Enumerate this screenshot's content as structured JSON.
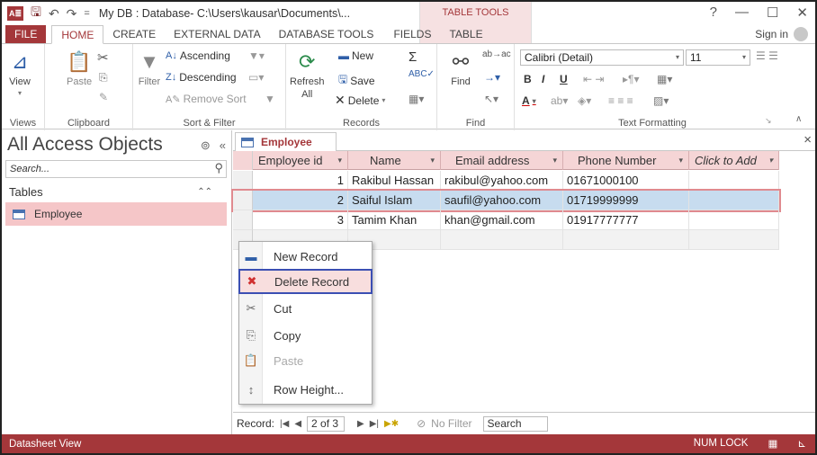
{
  "window": {
    "title": "My DB : Database- C:\\Users\\kausar\\Documents\\...",
    "context_tab_group": "TABLE TOOLS",
    "help": "?",
    "minimize": "—",
    "restore": "☐",
    "close": "✕"
  },
  "qat": {
    "save": "🖫",
    "undo": "↶",
    "redo": "↷",
    "customize": "="
  },
  "ribbon_tabs": [
    "FILE",
    "HOME",
    "CREATE",
    "EXTERNAL DATA",
    "DATABASE TOOLS",
    "FIELDS",
    "TABLE"
  ],
  "active_tab": "HOME",
  "signin": "Sign in",
  "ribbon": {
    "views": {
      "view_label": "View",
      "group": "Views"
    },
    "clipboard": {
      "paste_label": "Paste",
      "group": "Clipboard"
    },
    "sort_filter": {
      "filter_label": "Filter",
      "ascending": "Ascending",
      "descending": "Descending",
      "remove_sort": "Remove Sort",
      "group": "Sort & Filter"
    },
    "records": {
      "refresh_label": "Refresh",
      "refresh_sub": "All",
      "new": "New",
      "save": "Save",
      "delete": "Delete",
      "group": "Records"
    },
    "find": {
      "find_label": "Find",
      "group": "Find"
    },
    "text_formatting": {
      "font": "Calibri (Detail)",
      "size": "11",
      "bold": "B",
      "italic": "I",
      "underline": "U",
      "font_color": "A",
      "group": "Text Formatting"
    }
  },
  "nav_pane": {
    "title": "All Access Objects",
    "search_placeholder": "Search...",
    "section": "Tables",
    "items": [
      "Employee"
    ]
  },
  "document_tab": "Employee",
  "table": {
    "columns": [
      "Employee id",
      "Name",
      "Email address",
      "Phone Number",
      "Click to Add"
    ],
    "rows": [
      [
        "1",
        "Rakibul Hassan",
        "rakibul@yahoo.com",
        "01671000100",
        ""
      ],
      [
        "2",
        "Saiful Islam",
        "saufil@yahoo.com",
        "01719999999",
        ""
      ],
      [
        "3",
        "Tamim Khan",
        "khan@gmail.com",
        "01917777777",
        ""
      ]
    ],
    "selected_row": 2
  },
  "context_menu": {
    "items": [
      {
        "label": "New Record",
        "icon": "new-record-icon",
        "glyph": "▬"
      },
      {
        "label": "Delete Record",
        "icon": "delete-record-icon",
        "glyph": "✖"
      },
      {
        "label": "Cut",
        "icon": "scissors-icon",
        "glyph": "✂"
      },
      {
        "label": "Copy",
        "icon": "copy-icon",
        "glyph": "⎘"
      },
      {
        "label": "Paste",
        "icon": "paste-icon",
        "glyph": "📋"
      },
      {
        "label": "Row Height...",
        "icon": "row-height-icon",
        "glyph": "↕"
      }
    ],
    "highlighted": "Delete Record",
    "disabled": [
      "Paste"
    ]
  },
  "record_nav": {
    "label": "Record:",
    "position": "2 of 3",
    "filter": "No Filter",
    "search": "Search"
  },
  "status": {
    "left": "Datasheet View",
    "num_lock": "NUM LOCK"
  },
  "colors": {
    "accent": "#a4373a",
    "header_bg": "#f5d5d6",
    "selection": "#c7dcef",
    "menu_highlight_border": "#3b4fb3"
  }
}
